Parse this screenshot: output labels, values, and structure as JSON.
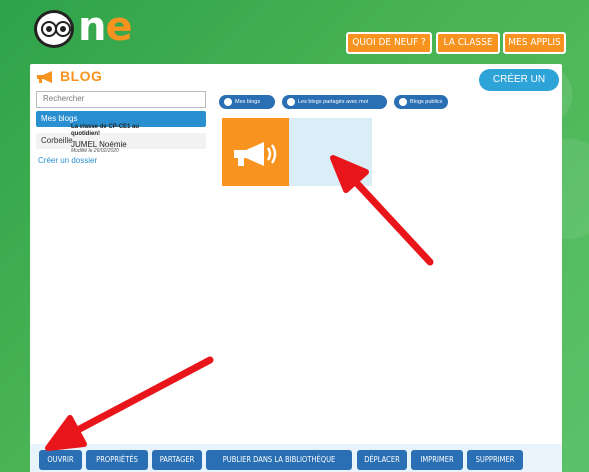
{
  "header": {
    "logo_text": "one",
    "nav": [
      "QUOI DE NEUF ?",
      "LA CLASSE",
      "MES APPLIS"
    ]
  },
  "page": {
    "title": "BLOG",
    "create_button": "CRÉER UN BLOG"
  },
  "sidebar": {
    "search_placeholder": "Rechercher",
    "items": [
      "Mes blogs",
      "Corbeille"
    ],
    "create_folder": "Créer un dossier"
  },
  "filters": [
    "Mes blogs",
    "Les blogs partagés avec moi",
    "Blogs publics"
  ],
  "blog_card": {
    "title": "La classe de CP-CE1 au quotidien!",
    "author": "JUMEL Noémie",
    "modified": "Modifié le 26/02/2020"
  },
  "toolbar": [
    "OUVRIR",
    "PROPRIÉTÉS",
    "PARTAGER",
    "PUBLIER DANS LA BIBLIOTHÈQUE",
    "DÉPLACER",
    "IMPRIMER",
    "SUPPRIMER"
  ],
  "colors": {
    "brand_green": "#3fae49",
    "accent_orange": "#f7931e",
    "primary_blue": "#2a6fb4",
    "annotation_red": "#e8161b"
  },
  "annotations": [
    "red-arrow-to-blog-card",
    "red-arrow-to-ouvrir-button"
  ]
}
